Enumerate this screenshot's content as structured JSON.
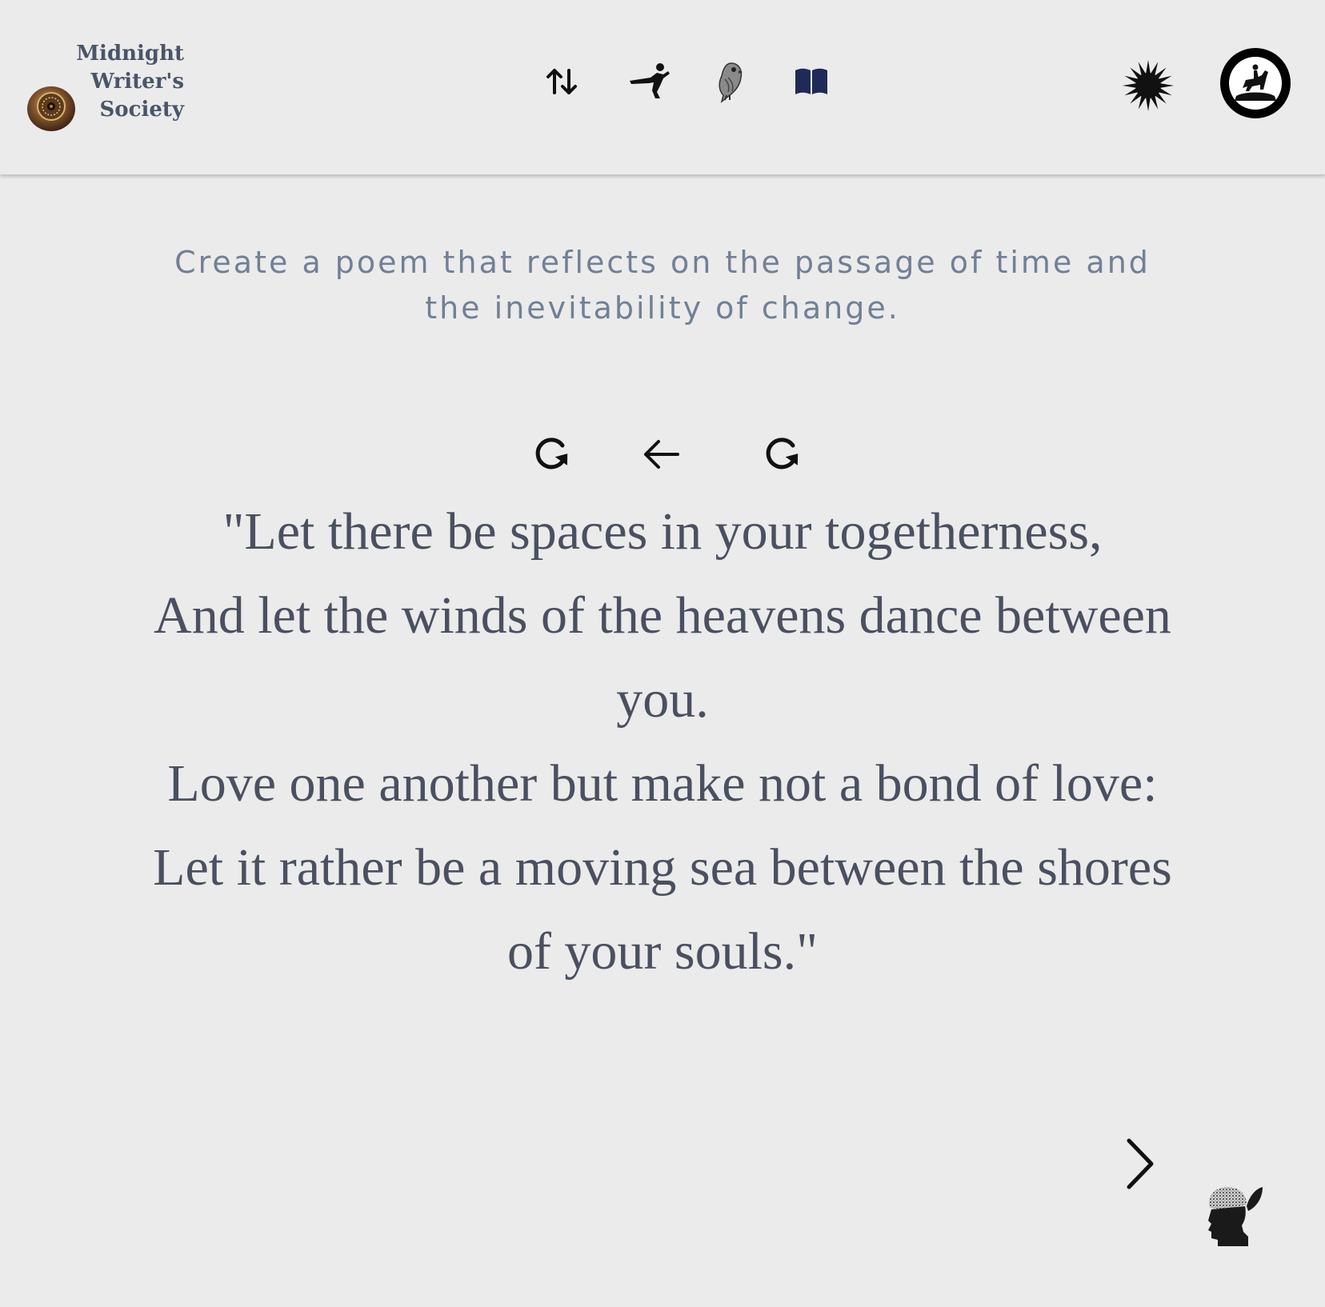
{
  "header": {
    "logo": {
      "lines": [
        "Midnight",
        "Writer's",
        "Society"
      ]
    },
    "nav_icons": [
      "sort-icon",
      "martial-arts-icon",
      "owl-icon",
      "book-icon"
    ],
    "right_icons": [
      "sun-theme-icon",
      "horse-rider-avatar-icon"
    ]
  },
  "prompt": {
    "text": "Create a poem that reflects on the passage of time and the inevitability of change."
  },
  "controls": [
    "refresh-icon",
    "back-arrow-icon",
    "regenerate-icon"
  ],
  "poem": {
    "lines": [
      "\"Let there be spaces in your togetherness,",
      "And let the winds of the heavens dance between you.",
      "Love one another but make not a bond of love:",
      "Let it rather be a moving sea between the shores of your souls.\""
    ]
  },
  "footer": {
    "next_icon": "chevron-right-icon",
    "brain_icon": "head-brain-icon"
  },
  "colors": {
    "background": "#ebebeb",
    "logo_text": "#4a5568",
    "prompt_text": "#718096",
    "poem_text": "#4a5060",
    "book_icon": "#1f2a56"
  }
}
